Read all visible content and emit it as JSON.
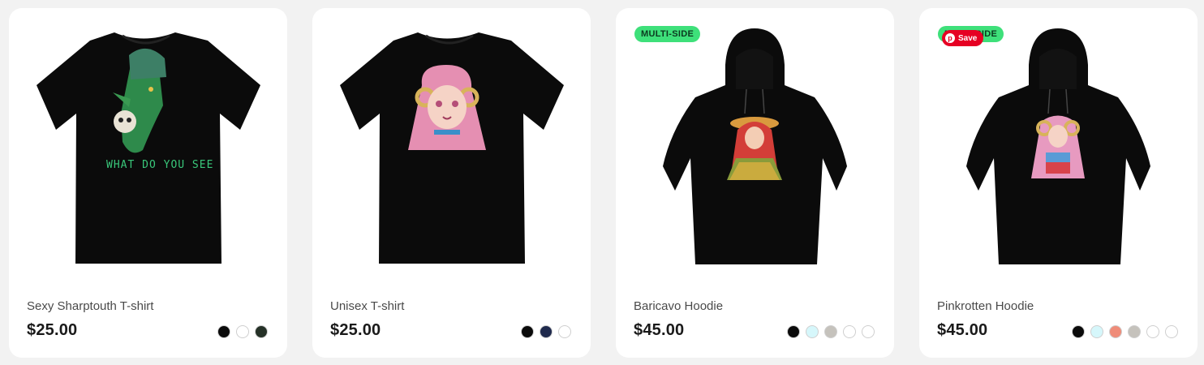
{
  "products": [
    {
      "name": "Sexy Sharptouth T-shirt",
      "price": "$25.00",
      "badge": "",
      "image": "tshirt-goblin-design-image",
      "garment": "tshirt",
      "print_text": "WHAT DO YOU SEE",
      "swatches": [
        "#0b0b0b",
        "#ffffff",
        "#253127"
      ]
    },
    {
      "name": "Unisex T-shirt",
      "price": "$25.00",
      "badge": "",
      "image": "tshirt-pink-hair-girl-image",
      "garment": "tshirt",
      "print_text": "",
      "swatches": [
        "#0b0b0b",
        "#1f2a4d",
        "#ffffff"
      ]
    },
    {
      "name": "Baricavo Hoodie",
      "price": "$45.00",
      "badge": "MULTI-SIDE",
      "image": "hoodie-redhead-girl-image",
      "garment": "hoodie",
      "print_text": "",
      "swatches": [
        "#0b0b0b",
        "#d6f7fb",
        "#c5c2bc",
        "#ffffff",
        "#ffffff"
      ]
    },
    {
      "name": "Pinkrotten Hoodie",
      "price": "$45.00",
      "badge": "MULTI-SIDE",
      "pin_save_label": "Save",
      "image": "hoodie-pink-hair-girl-image",
      "garment": "hoodie",
      "print_text": "",
      "swatches": [
        "#0b0b0b",
        "#d6f7fb",
        "#ef8c79",
        "#c5c2bc",
        "#ffffff",
        "#ffffff"
      ]
    }
  ],
  "colors": {
    "badge": "#3ee07a",
    "pinterest": "#e60023",
    "garment": "#0b0b0b"
  },
  "icons": {
    "pinterest": "pinterest-icon"
  }
}
